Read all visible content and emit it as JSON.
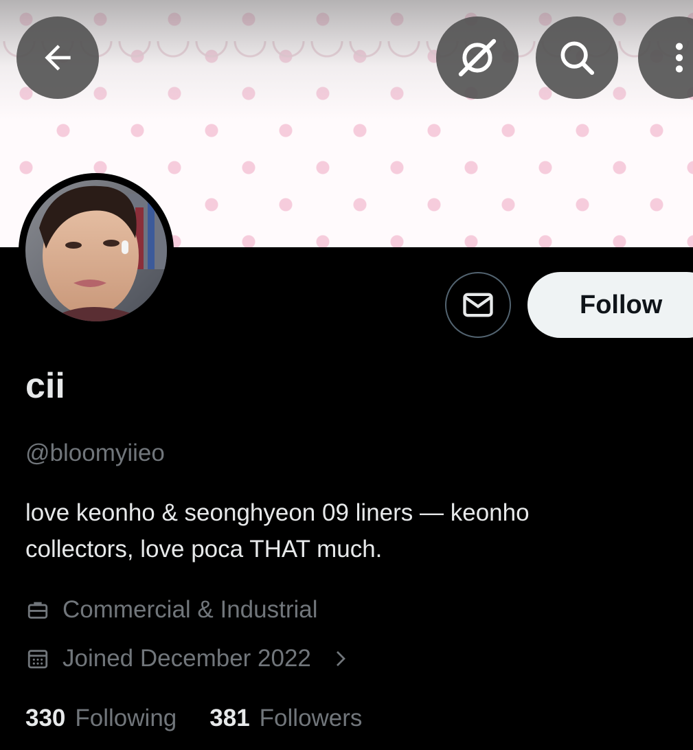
{
  "header": {
    "back_icon": "arrow-left-icon",
    "grok_icon": "grok-icon",
    "search_icon": "search-icon",
    "more_icon": "more-vertical-icon"
  },
  "profile": {
    "display_name": "cii",
    "handle": "@bloomyiieo",
    "bio_line1": "love keonho & seonghyeon 09 liners — keonho",
    "bio_line2": "collectors, love poca THAT much.",
    "category": "Commercial & Industrial",
    "joined": "Joined December 2022",
    "following_count": "330",
    "following_label": "Following",
    "followers_count": "381",
    "followers_label": "Followers"
  },
  "actions": {
    "message_icon": "envelope-icon",
    "follow_label": "Follow"
  },
  "colors": {
    "background": "#000000",
    "text_primary": "#e7e9ea",
    "text_secondary": "#71767b",
    "follow_button_bg": "#eff3f4",
    "banner_dot": "#f5c4d6"
  }
}
